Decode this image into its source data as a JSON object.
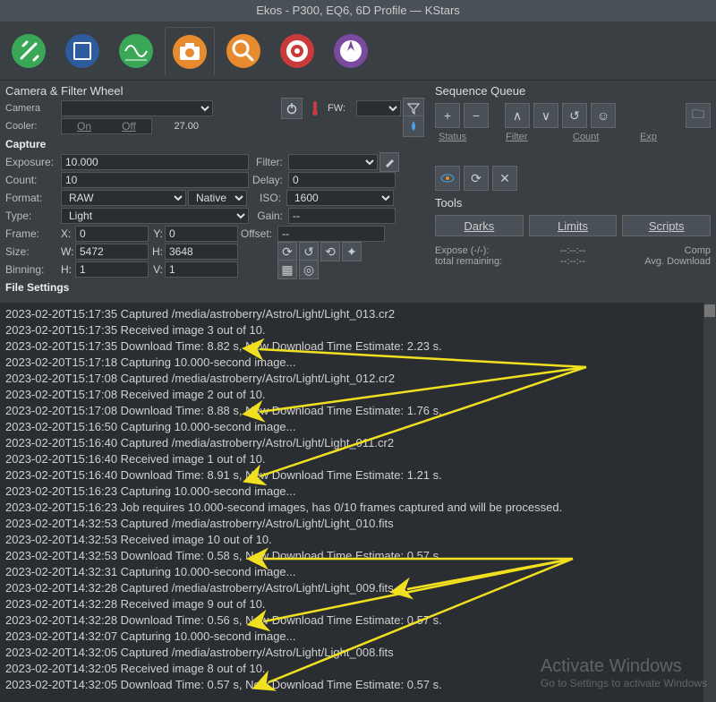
{
  "title": "Ekos - P300, EQ6, 6D Profile — KStars",
  "camera_panel": {
    "title": "Camera & Filter Wheel",
    "camera_lbl": "Camera",
    "cooler_lbl": "Cooler:",
    "cooler_on": "On",
    "cooler_off": "Off",
    "cooler_time": "27.00",
    "fw_lbl": "FW:",
    "capture_hdr": "Capture",
    "exposure_lbl": "Exposure:",
    "exposure_val": "10.000",
    "filter_lbl": "Filter:",
    "count_lbl": "Count:",
    "count_val": "10",
    "delay_lbl": "Delay:",
    "delay_val": "0",
    "format_lbl": "Format:",
    "format_val": "RAW",
    "native_val": "Native",
    "iso_lbl": "ISO:",
    "iso_val": "1600",
    "type_lbl": "Type:",
    "type_val": "Light",
    "gain_lbl": "Gain:",
    "gain_val": "--",
    "frame_lbl": "Frame:",
    "frame_x_lbl": "X:",
    "frame_x": "0",
    "frame_y_lbl": "Y:",
    "frame_y": "0",
    "offset_lbl": "Offset:",
    "offset_val": "--",
    "size_lbl": "Size:",
    "size_w_lbl": "W:",
    "size_w": "5472",
    "size_h_lbl": "H:",
    "size_h": "3648",
    "binning_lbl": "Binning:",
    "bin_h_lbl": "H:",
    "bin_h": "1",
    "bin_v_lbl": "V:",
    "bin_v": "1",
    "file_settings": "File Settings"
  },
  "seq": {
    "title": "Sequence Queue",
    "col_status": "Status",
    "col_filter": "Filter",
    "col_count": "Count",
    "col_exp": "Exp",
    "tools_title": "Tools",
    "darks": "Darks",
    "limits": "Limits",
    "scripts": "Scripts",
    "expose_lbl": "Expose (-/-):",
    "expose_val": "--:--:--",
    "total_lbl": "total remaining:",
    "total_val": "--:--:--",
    "comp_lbl": "Comp",
    "avg_lbl": "Avg. Download"
  },
  "log": [
    "2023-02-20T15:17:35 Captured /media/astroberry/Astro/Light/Light_013.cr2",
    "2023-02-20T15:17:35 Received image 3 out of 10.",
    "2023-02-20T15:17:35 Download Time: 8.82 s, New Download Time Estimate: 2.23 s.",
    "2023-02-20T15:17:18 Capturing 10.000-second  image...",
    "2023-02-20T15:17:08 Captured /media/astroberry/Astro/Light/Light_012.cr2",
    "2023-02-20T15:17:08 Received image 2 out of 10.",
    "2023-02-20T15:17:08 Download Time: 8.88 s, New Download Time Estimate: 1.76 s.",
    "2023-02-20T15:16:50 Capturing 10.000-second  image...",
    "2023-02-20T15:16:40 Captured /media/astroberry/Astro/Light/Light_011.cr2",
    "2023-02-20T15:16:40 Received image 1 out of 10.",
    "2023-02-20T15:16:40 Download Time: 8.91 s, New Download Time Estimate: 1.21 s.",
    "2023-02-20T15:16:23 Capturing 10.000-second  image...",
    "2023-02-20T15:16:23 Job requires 10.000-second  images, has 0/10 frames captured and will be processed.",
    "2023-02-20T14:32:53 Captured /media/astroberry/Astro/Light/Light_010.fits",
    "2023-02-20T14:32:53 Received image 10 out of 10.",
    "2023-02-20T14:32:53 Download Time: 0.58 s, New Download Time Estimate: 0.57 s.",
    "2023-02-20T14:32:31 Capturing 10.000-second  image...",
    "2023-02-20T14:32:28 Captured /media/astroberry/Astro/Light/Light_009.fits",
    "2023-02-20T14:32:28 Received image 9 out of 10.",
    "2023-02-20T14:32:28 Download Time: 0.56 s, New Download Time Estimate: 0.57 s.",
    "2023-02-20T14:32:07 Capturing 10.000-second  image...",
    "2023-02-20T14:32:05 Captured /media/astroberry/Astro/Light/Light_008.fits",
    "2023-02-20T14:32:05 Received image 8 out of 10.",
    "2023-02-20T14:32:05 Download Time: 0.57 s, New Download Time Estimate: 0.57 s."
  ],
  "watermark": {
    "l1": "Activate Windows",
    "l2": "Go to Settings to activate Windows"
  }
}
